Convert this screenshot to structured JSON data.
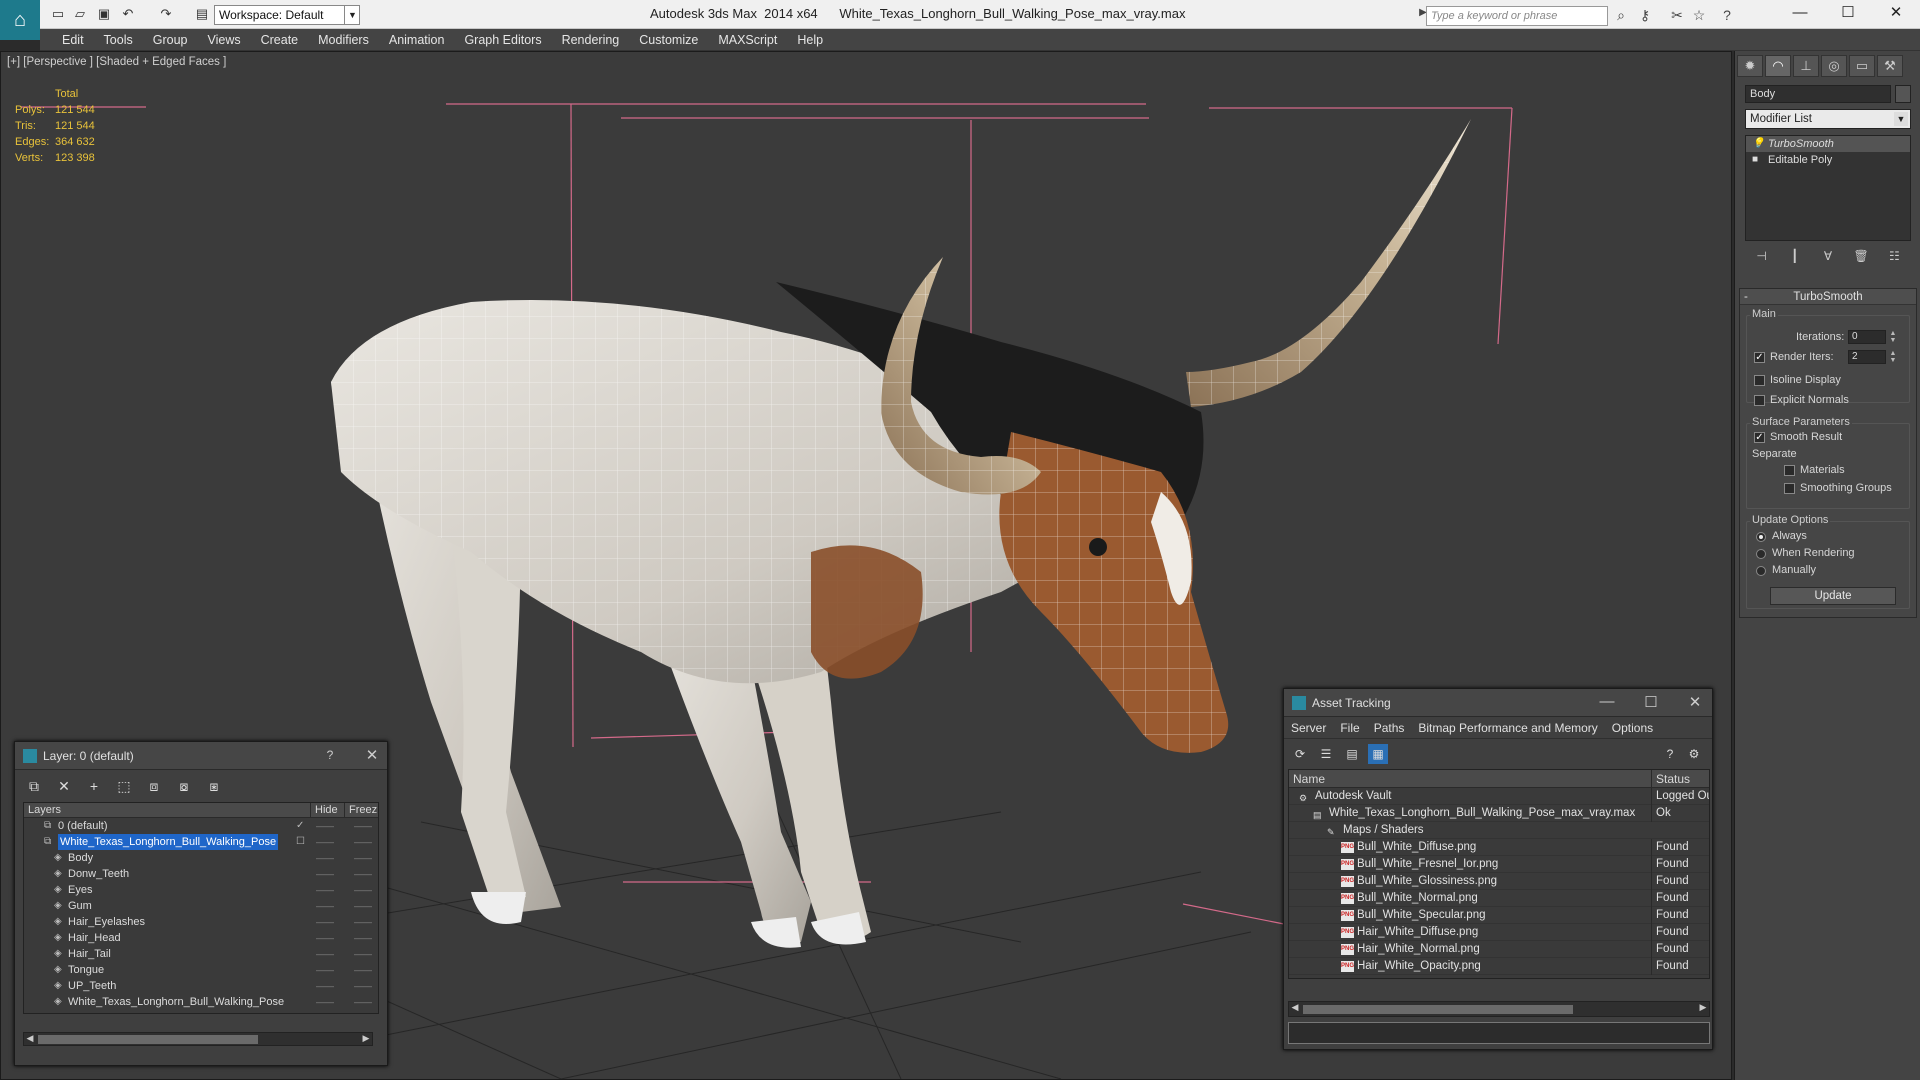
{
  "titlebar": {
    "app": "Autodesk 3ds Max  2014 x64",
    "file": "White_Texas_Longhorn_Bull_Walking_Pose_max_vray.max",
    "workspace": "Workspace: Default",
    "search_placeholder": "Type a keyword or phrase",
    "min": "—",
    "max": "☐",
    "close": "✕"
  },
  "menu": [
    "Edit",
    "Tools",
    "Group",
    "Views",
    "Create",
    "Modifiers",
    "Animation",
    "Graph Editors",
    "Rendering",
    "Customize",
    "MAXScript",
    "Help"
  ],
  "viewport": {
    "label": "[+] [Perspective ] [Shaded + Edged Faces ]",
    "stats_header": "Total",
    "stats": [
      {
        "k": "Polys:",
        "v": "121 544"
      },
      {
        "k": "Tris:",
        "v": "121 544"
      },
      {
        "k": "Edges:",
        "v": "364 632"
      },
      {
        "k": "Verts:",
        "v": "123 398"
      }
    ]
  },
  "command_panel": {
    "object_name": "Body",
    "modifier_list": "Modifier List",
    "stack": [
      "TurboSmooth",
      "Editable Poly"
    ],
    "rollout_title": "TurboSmooth",
    "main_group": "Main",
    "iterations_label": "Iterations:",
    "iterations_value": "0",
    "render_iters_label": "Render Iters:",
    "render_iters_value": "2",
    "isoline_label": "Isoline Display",
    "explicit_normals_label": "Explicit Normals",
    "surface_group": "Surface Parameters",
    "smooth_result_label": "Smooth Result",
    "separate_label": "Separate",
    "materials_label": "Materials",
    "smoothing_groups_label": "Smoothing Groups",
    "update_group": "Update Options",
    "always_label": "Always",
    "when_rendering_label": "When Rendering",
    "manually_label": "Manually",
    "update_button": "Update",
    "render_iters_checked": true,
    "smooth_result_checked": true,
    "update_option_selected": "Always"
  },
  "layer_dialog": {
    "title": "Layer: 0 (default)",
    "help": "?",
    "close": "✕",
    "col_layers": "Layers",
    "col_hide": "Hide",
    "col_freeze": "Freez",
    "rows": [
      {
        "name": "0 (default)",
        "level": 1
      },
      {
        "name": "White_Texas_Longhorn_Bull_Walking_Pose",
        "level": 1
      },
      {
        "name": "Body",
        "level": 2
      },
      {
        "name": "Donw_Teeth",
        "level": 2
      },
      {
        "name": "Eyes",
        "level": 2
      },
      {
        "name": "Gum",
        "level": 2
      },
      {
        "name": "Hair_Eyelashes",
        "level": 2
      },
      {
        "name": "Hair_Head",
        "level": 2
      },
      {
        "name": "Hair_Tail",
        "level": 2
      },
      {
        "name": "Tongue",
        "level": 2
      },
      {
        "name": "UP_Teeth",
        "level": 2
      },
      {
        "name": "White_Texas_Longhorn_Bull_Walking_Pose",
        "level": 2
      }
    ],
    "selected_row": "White_Texas_Longhorn_Bull_Walking_Pose"
  },
  "asset_dialog": {
    "title": "Asset Tracking",
    "menu": [
      "Server",
      "File",
      "Paths",
      "Bitmap Performance and Memory",
      "Options"
    ],
    "col_name": "Name",
    "col_status": "Status",
    "rows": [
      {
        "name": "Autodesk Vault",
        "status": "Logged Ou",
        "level": 0
      },
      {
        "name": "White_Texas_Longhorn_Bull_Walking_Pose_max_vray.max",
        "status": "Ok",
        "level": 1
      },
      {
        "name": "Maps / Shaders",
        "status": "",
        "level": 2
      },
      {
        "name": "Bull_White_Diffuse.png",
        "status": "Found",
        "level": 3
      },
      {
        "name": "Bull_White_Fresnel_Ior.png",
        "status": "Found",
        "level": 3
      },
      {
        "name": "Bull_White_Glossiness.png",
        "status": "Found",
        "level": 3
      },
      {
        "name": "Bull_White_Normal.png",
        "status": "Found",
        "level": 3
      },
      {
        "name": "Bull_White_Specular.png",
        "status": "Found",
        "level": 3
      },
      {
        "name": "Hair_White_Diffuse.png",
        "status": "Found",
        "level": 3
      },
      {
        "name": "Hair_White_Normal.png",
        "status": "Found",
        "level": 3
      },
      {
        "name": "Hair_White_Opacity.png",
        "status": "Found",
        "level": 3
      }
    ]
  },
  "colors": {
    "selection": "#1f66c9",
    "stats": "#e8c23a",
    "bbox": "#d46a8a"
  }
}
